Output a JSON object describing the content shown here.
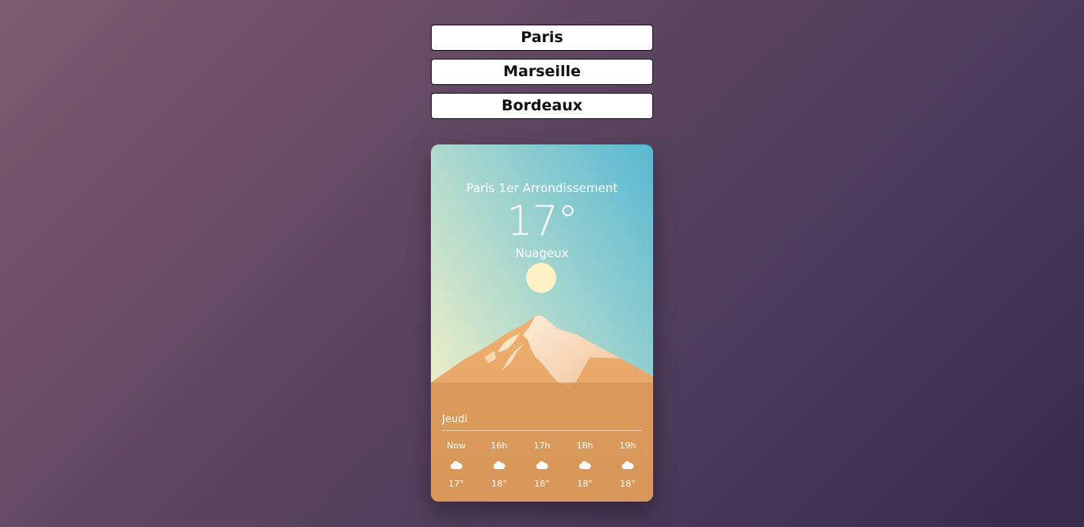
{
  "cities": [
    {
      "label": "Paris"
    },
    {
      "label": "Marseille"
    },
    {
      "label": "Bordeaux"
    }
  ],
  "weather": {
    "location": "Paris 1er Arrondissement",
    "temperature": "17°",
    "condition": "Nuageux",
    "day": "Jeudi",
    "hourly": [
      {
        "time": "Now",
        "icon": "cloud-icon",
        "temp": "17°"
      },
      {
        "time": "16h",
        "icon": "cloud-icon",
        "temp": "18°"
      },
      {
        "time": "17h",
        "icon": "cloud-icon",
        "temp": "18°"
      },
      {
        "time": "18h",
        "icon": "cloud-icon",
        "temp": "18°"
      },
      {
        "time": "19h",
        "icon": "cloud-icon",
        "temp": "18°"
      }
    ]
  },
  "colors": {
    "sky_top": "#5fbcd3",
    "sky_bottom": "#e8ecc6",
    "sun": "#fdf0c4",
    "mountain": "#e0a060",
    "ground": "#d89a5a"
  }
}
